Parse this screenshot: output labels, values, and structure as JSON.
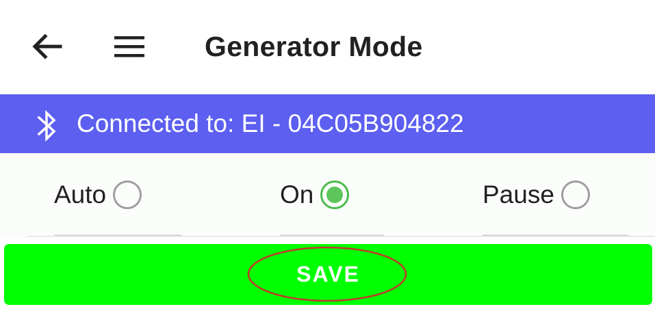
{
  "appbar": {
    "title": "Generator Mode",
    "back_icon": "arrow-left-icon",
    "menu_icon": "hamburger-menu-icon"
  },
  "connection": {
    "icon": "bluetooth-icon",
    "text": "Connected to: EI - 04C05B904822",
    "background": "#5c5ff0"
  },
  "modes": {
    "options": [
      {
        "label": "Auto",
        "selected": false
      },
      {
        "label": "On",
        "selected": true
      },
      {
        "label": "Pause",
        "selected": false
      }
    ],
    "selected_color": "#4cbb4c"
  },
  "actions": {
    "save_label": "SAVE",
    "save_color": "#00ff00",
    "highlight_color": "#c0392b"
  }
}
